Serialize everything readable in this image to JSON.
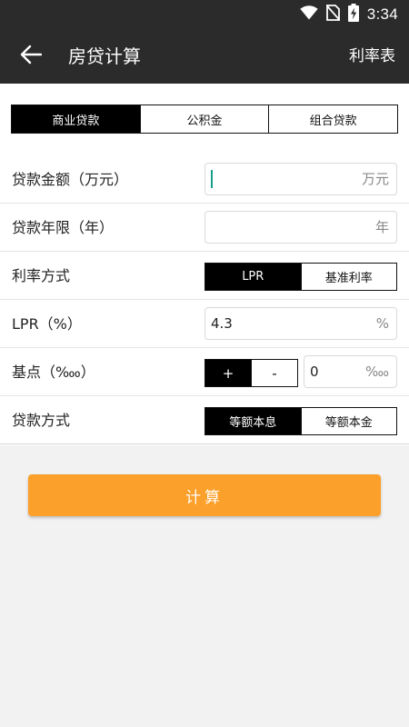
{
  "status_bar": {
    "time": "3:34",
    "icons": [
      "wifi-icon",
      "no-sim-icon",
      "battery-charging-icon"
    ]
  },
  "app_bar": {
    "title": "房贷计算",
    "action_label": "利率表",
    "back_icon": "arrow-left-icon"
  },
  "loan_type_tabs": [
    {
      "label": "商业贷款",
      "active": true
    },
    {
      "label": "公积金",
      "active": false
    },
    {
      "label": "组合贷款",
      "active": false
    }
  ],
  "form": {
    "amount": {
      "label": "贷款金额（万元）",
      "value": "",
      "unit": "万元"
    },
    "term": {
      "label": "贷款年限（年）",
      "value": "",
      "unit": "年"
    },
    "rate_mode": {
      "label": "利率方式",
      "options": [
        {
          "label": "LPR",
          "active": true
        },
        {
          "label": "基准利率",
          "active": false
        }
      ]
    },
    "lpr": {
      "label": "LPR（%）",
      "value": "4.3",
      "unit": "%"
    },
    "basis_points": {
      "label": "基点（‱）",
      "plus_label": "+",
      "minus_label": "-",
      "value": "0",
      "unit": "‱"
    },
    "repayment": {
      "label": "贷款方式",
      "options": [
        {
          "label": "等额本息",
          "active": true
        },
        {
          "label": "等额本金",
          "active": false
        }
      ]
    }
  },
  "calculate_button": {
    "label": "计算"
  },
  "colors": {
    "header_bg": "#2b2b2b",
    "accent": "#fba02a",
    "caret": "#199e8c"
  }
}
